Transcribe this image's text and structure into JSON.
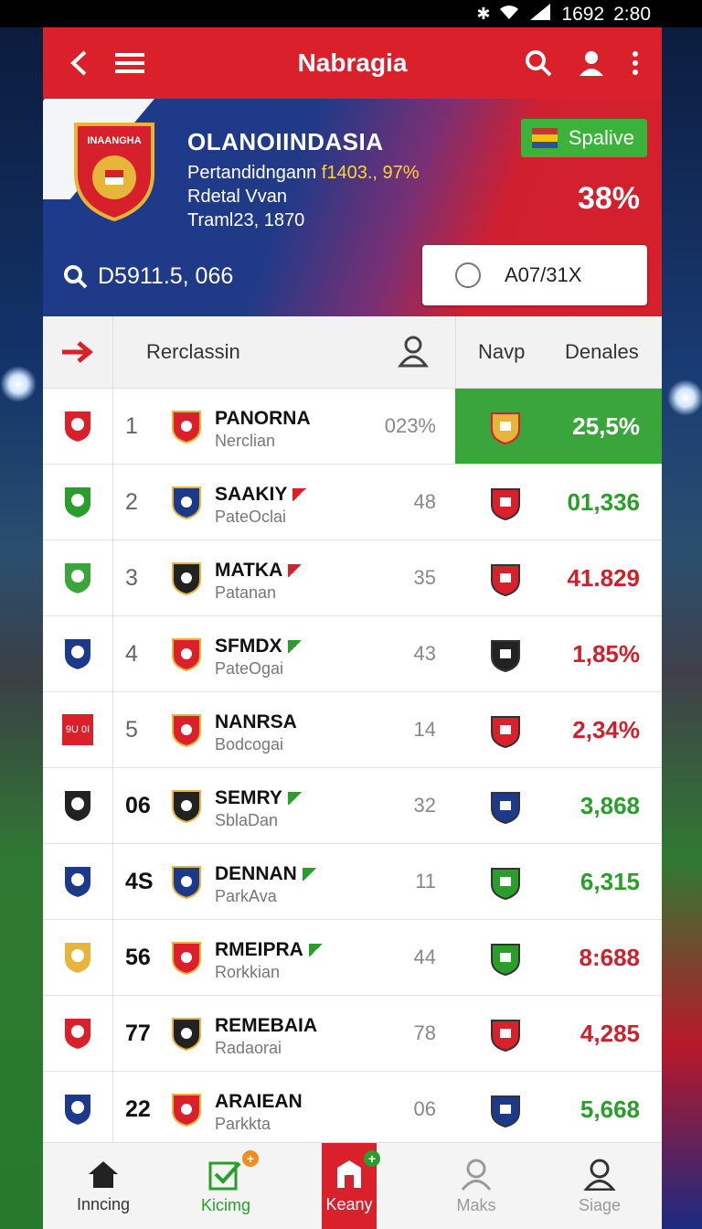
{
  "status_bar": {
    "signal_text": "1692",
    "time": "2:80"
  },
  "header": {
    "title": "Nabragia"
  },
  "hero": {
    "team_name": "OLANOIINDASIA",
    "crest_text": "INAANGHA",
    "line1_prefix": "Pertandidngann ",
    "line1_highlight": "f1403., 97%",
    "line2": "Rdetal Vvan",
    "line3": "Traml23, 1870",
    "chip_label": "Spalive",
    "percent": "38%",
    "search_text": "D5911.5, 066",
    "select_value": "A07/31X"
  },
  "table": {
    "header_title": "Rerclassin",
    "col_navp": "Navp",
    "col_denales": "Denales",
    "rows": [
      {
        "rank": "1",
        "name": "PANORNA",
        "sub": "Nerclian",
        "num": "023%",
        "value": "25,5%",
        "value_color": "white",
        "highlight": true,
        "side_icon": "shield-red-icon"
      },
      {
        "rank": "2",
        "name": "SAAKIY",
        "sub": "PateOclai",
        "num": "48",
        "value": "01,336",
        "value_color": "green",
        "highlight": false,
        "side_icon": "circle-eagle-icon"
      },
      {
        "rank": "3",
        "name": "MATKA",
        "sub": "Patanan",
        "num": "35",
        "value": "41.829",
        "value_color": "red",
        "highlight": false,
        "side_icon": "dragon-icon"
      },
      {
        "rank": "4",
        "name": "SFMDX",
        "sub": "PateOgai",
        "num": "43",
        "value": "1,85%",
        "value_color": "red",
        "highlight": false,
        "side_icon": "round-crest-icon"
      },
      {
        "rank": "5",
        "name": "NANRSA",
        "sub": "Bodcogai",
        "num": "14",
        "value": "2,34%",
        "value_color": "red",
        "highlight": false,
        "side_icon": "square-red-icon",
        "side_text": "9U 0I"
      },
      {
        "rank": "06",
        "name": "SEMRY",
        "sub": "SblaDan",
        "num": "32",
        "value": "3,868",
        "value_color": "green",
        "highlight": false,
        "side_icon": "tricolor-shield-icon"
      },
      {
        "rank": "4S",
        "name": "DENNAN",
        "sub": "ParkAva",
        "num": "11",
        "value": "6,315",
        "value_color": "green",
        "highlight": false,
        "side_icon": "blue-shield-icon"
      },
      {
        "rank": "56",
        "name": "RMEIPRA",
        "sub": "Rorkkian",
        "num": "44",
        "value": "8:688",
        "value_color": "red",
        "highlight": false,
        "side_icon": "gold-shield-icon"
      },
      {
        "rank": "77",
        "name": "REMEBAIA",
        "sub": "Radaorai",
        "num": "78",
        "value": "4,285",
        "value_color": "red",
        "highlight": false,
        "side_icon": "red-white-shield-icon"
      },
      {
        "rank": "22",
        "name": "ARAIEAN",
        "sub": "Parkkta",
        "num": "06",
        "value": "5,668",
        "value_color": "green",
        "highlight": false,
        "side_icon": "blue-cross-shield-icon"
      }
    ]
  },
  "bottom_nav": {
    "items": [
      {
        "label": "Inncing",
        "icon": "home-icon"
      },
      {
        "label": "Kicimg",
        "icon": "checkbox-icon"
      },
      {
        "label": "Keany",
        "icon": "house-outline-icon"
      },
      {
        "label": "Maks",
        "icon": "user-icon"
      },
      {
        "label": "Siage",
        "icon": "user-icon"
      }
    ]
  },
  "colors": {
    "brand_red": "#d9202b",
    "accent_green": "#3aa53a",
    "hero_blue": "#1d3a8a"
  }
}
